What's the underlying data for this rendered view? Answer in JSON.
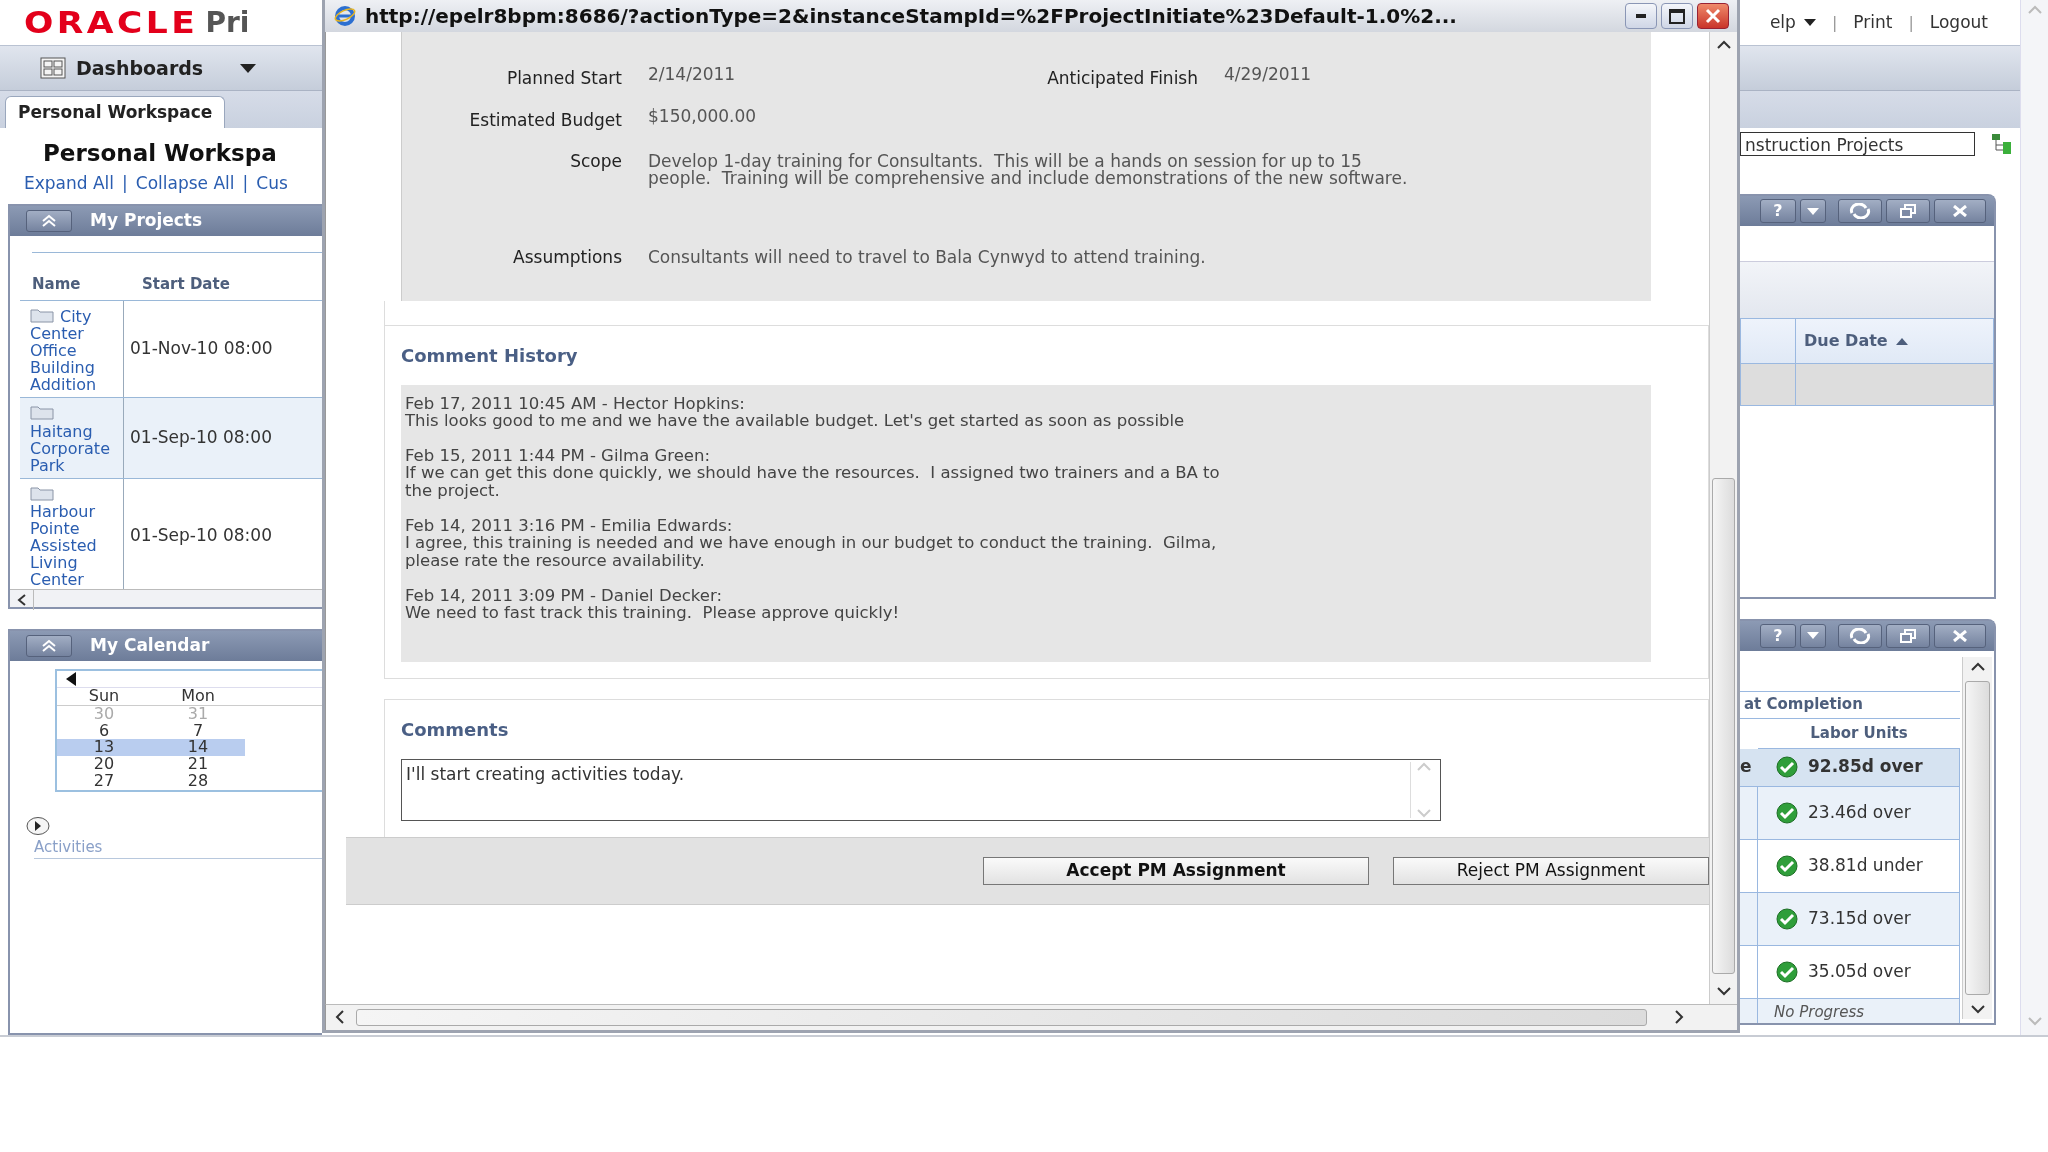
{
  "header": {
    "logo": "ORACLE",
    "product": "Pri",
    "separator": "|",
    "links": [
      {
        "label": "elp",
        "dropdown": true
      },
      {
        "label": "Print",
        "dropdown": false
      },
      {
        "label": "Logout",
        "dropdown": false
      }
    ]
  },
  "nav": {
    "label": "Dashboards"
  },
  "tabs": [
    {
      "label": "Personal Workspace",
      "selected": true
    }
  ],
  "workspace": {
    "title": "Personal Workspa",
    "separator": "|",
    "links": [
      "Expand All",
      "Collapse All",
      "Cus"
    ]
  },
  "my_projects": {
    "title": "My Projects",
    "columns": [
      "Name",
      "Start Date"
    ],
    "rows": [
      {
        "name": "City Center Office Building Addition",
        "start_date": "01-Nov-10 08:00"
      },
      {
        "name": "Haitang Corporate Park",
        "start_date": "01-Sep-10 08:00"
      },
      {
        "name": "Harbour Pointe Assisted Living Center",
        "start_date": "01-Sep-10 08:00"
      }
    ]
  },
  "my_calendar": {
    "title": "My Calendar",
    "days": [
      "Sun",
      "Mon"
    ],
    "weeks": [
      {
        "selected": false,
        "days": [
          {
            "label": "30",
            "muted": true
          },
          {
            "label": "31",
            "muted": true
          }
        ]
      },
      {
        "selected": false,
        "days": [
          {
            "label": "6",
            "muted": false
          },
          {
            "label": "7",
            "muted": false
          }
        ]
      },
      {
        "selected": true,
        "days": [
          {
            "label": "13",
            "muted": false
          },
          {
            "label": "14",
            "muted": false
          }
        ]
      },
      {
        "selected": false,
        "days": [
          {
            "label": "20",
            "muted": false
          },
          {
            "label": "21",
            "muted": false
          }
        ]
      },
      {
        "selected": false,
        "days": [
          {
            "label": "27",
            "muted": false
          },
          {
            "label": "28",
            "muted": false
          }
        ]
      }
    ],
    "activities": "Activities"
  },
  "project_filter": {
    "value": "nstruction Projects"
  },
  "due_portlet": {
    "help": "?",
    "columns": [
      "Due Date"
    ]
  },
  "units_portlet": {
    "help": "?",
    "group_header": "at Completion",
    "column": "Labor Units",
    "rows": [
      {
        "kind": "value",
        "lead": "e",
        "value": "92.85d over",
        "selected": true
      },
      {
        "kind": "value",
        "value": "23.46d over",
        "selected": false
      },
      {
        "kind": "value",
        "value": "38.81d under",
        "selected": false
      },
      {
        "kind": "value",
        "value": "73.15d over",
        "selected": false
      },
      {
        "kind": "value",
        "value": "35.05d over",
        "selected": false
      },
      {
        "kind": "note",
        "value": "No Progress",
        "selected": false
      }
    ]
  },
  "popup": {
    "title": "http://epelr8bpm:8686/?actionType=2&instanceStampId=%2FProjectInitiate%23Default-1.0%2...",
    "fields": [
      {
        "label": "Planned Start",
        "value": "2/14/2011",
        "label_2": "Anticipated Finish",
        "value_2": "4/29/2011"
      },
      {
        "label": "Estimated Budget",
        "value": "$150,000.00"
      },
      {
        "label": "Scope",
        "value": "Develop 1-day training for Consultants.  This will be a hands on session for up to 15 people.  Training will be comprehensive and include demonstrations of the new software."
      },
      {
        "label": "Assumptions",
        "value": "Consultants will need to travel to Bala Cynwyd to attend training."
      }
    ],
    "comment_history": {
      "title": "Comment History",
      "entries": [
        {
          "heading": "Feb 17, 2011 10:45 AM - Hector Hopkins:",
          "text": "This looks good to me and we have the available budget. Let's get started as soon as possible"
        },
        {
          "heading": "Feb 15, 2011 1:44 PM - Gilma Green:",
          "text": "If we can get this done quickly, we should have the resources.  I assigned two trainers and a BA to the project."
        },
        {
          "heading": "Feb 14, 2011 3:16 PM - Emilia Edwards:",
          "text": "I agree, this training is needed and we have enough in our budget to conduct the training.  Gilma, please rate the resource availability."
        },
        {
          "heading": "Feb 14, 2011 3:09 PM - Daniel Decker:",
          "text": "We need to fast track this training.  Please approve quickly!"
        }
      ]
    },
    "comments": {
      "title": "Comments",
      "value": "I'll start creating activities today."
    },
    "buttons": [
      {
        "label": "Accept PM Assignment",
        "primary": true
      },
      {
        "label": "Reject PM Assignment",
        "primary": false
      }
    ]
  }
}
